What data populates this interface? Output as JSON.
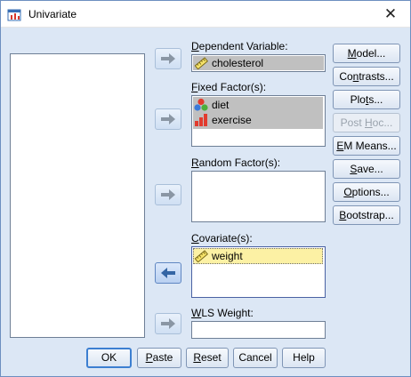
{
  "window": {
    "title": "Univariate",
    "close_glyph": "✕"
  },
  "dependent": {
    "label_mn": "D",
    "label_rest": "ependent Variable:",
    "items": [
      {
        "name": "cholesterol",
        "icon": "ruler-icon"
      }
    ]
  },
  "fixed": {
    "label_mn": "F",
    "label_rest": "ixed Factor(s):",
    "items": [
      {
        "name": "diet",
        "icon": "nominal-icon"
      },
      {
        "name": "exercise",
        "icon": "ordinal-icon"
      }
    ]
  },
  "random": {
    "label_mn": "R",
    "label_rest": "andom Factor(s):",
    "items": []
  },
  "covariates": {
    "label_mn": "C",
    "label_rest": "ovariate(s):",
    "items": [
      {
        "name": "weight",
        "icon": "ruler-icon"
      }
    ]
  },
  "wls": {
    "label_mn": "W",
    "label_rest": "LS Weight:",
    "value": ""
  },
  "side_buttons": [
    {
      "pre": "",
      "mn": "M",
      "post": "odel...",
      "enabled": true
    },
    {
      "pre": "Co",
      "mn": "n",
      "post": "trasts...",
      "enabled": true
    },
    {
      "pre": "Plo",
      "mn": "t",
      "post": "s...",
      "enabled": true
    },
    {
      "pre": "Post ",
      "mn": "H",
      "post": "oc...",
      "enabled": false
    },
    {
      "pre": "",
      "mn": "E",
      "post": "M Means...",
      "enabled": true
    },
    {
      "pre": "",
      "mn": "S",
      "post": "ave...",
      "enabled": true
    },
    {
      "pre": "",
      "mn": "O",
      "post": "ptions...",
      "enabled": true
    },
    {
      "pre": "",
      "mn": "B",
      "post": "ootstrap...",
      "enabled": true
    }
  ],
  "bottom_buttons": [
    {
      "pre": "OK",
      "mn": "",
      "post": ""
    },
    {
      "pre": "",
      "mn": "P",
      "post": "aste"
    },
    {
      "pre": "",
      "mn": "R",
      "post": "eset"
    },
    {
      "pre": "Cancel",
      "mn": "",
      "post": ""
    },
    {
      "pre": "Help",
      "mn": "",
      "post": ""
    }
  ],
  "colors": {
    "selected_gray": "#c0c0c0",
    "selected_yellow": "#fcf1a4",
    "arrow_gray": "#8a96a4",
    "arrow_active": "#3465a4"
  }
}
